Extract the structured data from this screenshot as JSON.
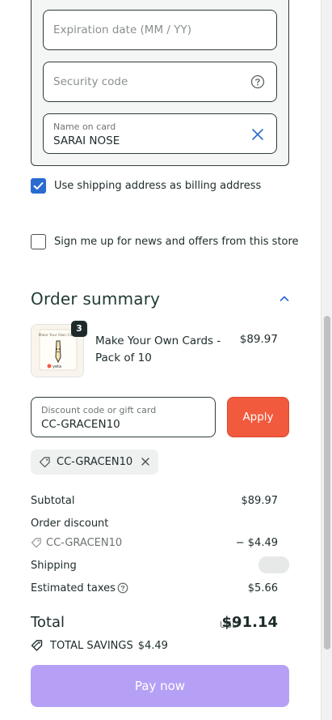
{
  "payment": {
    "expiration_placeholder": "Expiration date (MM / YY)",
    "security_placeholder": "Security code",
    "name_label": "Name on card",
    "name_value": "SARAI NOSE"
  },
  "billing": {
    "use_shipping_label": "Use shipping address as billing address",
    "use_shipping_checked": true,
    "newsletter_label": "Sign me up for news and offers from this store",
    "newsletter_checked": false
  },
  "summary": {
    "title": "Order summary",
    "item": {
      "name": "Make Your Own Cards - Pack of 10",
      "price": "$89.97",
      "quantity": "3",
      "thumb_brand": "yeta",
      "thumb_caption": "Make Your Own Cards"
    },
    "discount": {
      "label": "Discount code or gift card",
      "value": "CC-GRACEN10",
      "apply_label": "Apply",
      "applied_code": "CC-GRACEN10"
    },
    "rows": {
      "subtotal_label": "Subtotal",
      "subtotal_value": "$89.97",
      "order_discount_label": "Order discount",
      "discount_code": "CC-GRACEN10",
      "discount_value": "− $4.49",
      "shipping_label": "Shipping",
      "taxes_label": "Estimated taxes",
      "taxes_value": "$5.66"
    },
    "total": {
      "label": "Total",
      "currency": "USD",
      "value": "$91.14",
      "savings_label": "TOTAL SAVINGS",
      "savings_value": "$4.49"
    },
    "pay_label": "Pay now"
  },
  "colors": {
    "apply_button": "#f25a3e",
    "pay_button": "#b6a0f6",
    "checkbox_checked": "#2b6bd1"
  }
}
